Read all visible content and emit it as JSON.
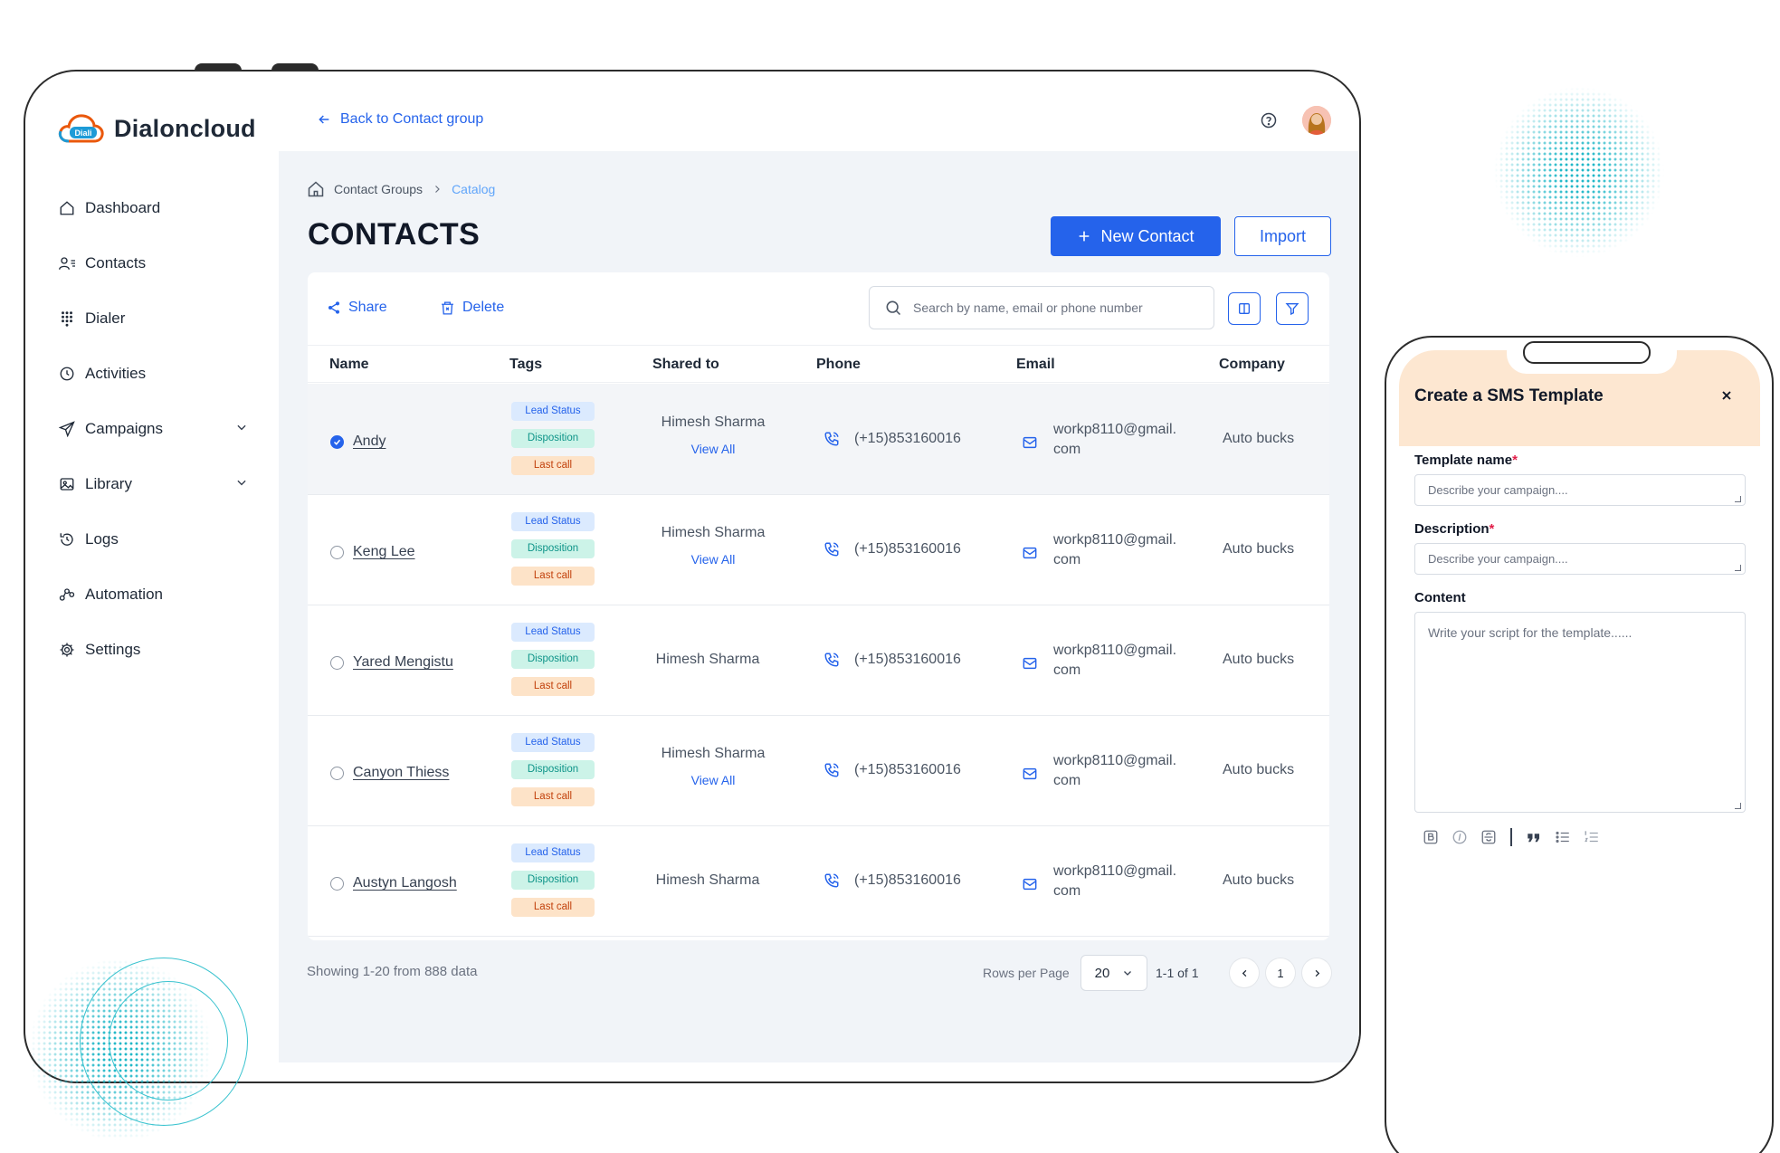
{
  "app": {
    "logo_badge": "Diali",
    "name": "Dialoncloud"
  },
  "sidebar": {
    "items": [
      {
        "label": "Dashboard",
        "icon": "home-icon"
      },
      {
        "label": "Contacts",
        "icon": "users-icon"
      },
      {
        "label": "Dialer",
        "icon": "dialpad-icon"
      },
      {
        "label": "Activities",
        "icon": "clock-icon"
      },
      {
        "label": "Campaigns",
        "icon": "send-icon",
        "expandable": true
      },
      {
        "label": "Library",
        "icon": "image-icon",
        "expandable": true
      },
      {
        "label": "Logs",
        "icon": "history-icon"
      },
      {
        "label": "Automation",
        "icon": "flow-icon"
      },
      {
        "label": "Settings",
        "icon": "gear-icon"
      }
    ]
  },
  "topbar": {
    "back_label": "Back to Contact group"
  },
  "breadcrumb": {
    "parent": "Contact Groups",
    "current": "Catalog"
  },
  "page": {
    "title": "CONTACTS",
    "new_contact_label": "New Contact",
    "import_label": "Import"
  },
  "toolbar": {
    "share_label": "Share",
    "delete_label": "Delete",
    "search_placeholder": "Search by name, email or phone number"
  },
  "table": {
    "columns": [
      "Name",
      "Tags",
      "Shared to",
      "Phone",
      "Email",
      "Company"
    ],
    "tags": [
      "Lead Status",
      "Disposition",
      "Last call"
    ],
    "view_all_label": "View All",
    "rows": [
      {
        "name": "Andy",
        "selected": true,
        "shared_to": "Himesh Sharma",
        "view_all": true,
        "phone": "(+15)853160016",
        "email_1": "workp8110@gmail.",
        "email_2": "com",
        "company": "Auto bucks"
      },
      {
        "name": "Keng Lee",
        "selected": false,
        "shared_to": "Himesh Sharma",
        "view_all": true,
        "phone": "(+15)853160016",
        "email_1": "workp8110@gmail.",
        "email_2": "com",
        "company": "Auto bucks"
      },
      {
        "name": "Yared Mengistu",
        "selected": false,
        "shared_to": "Himesh Sharma",
        "view_all": false,
        "phone": "(+15)853160016",
        "email_1": "workp8110@gmail.",
        "email_2": "com",
        "company": "Auto bucks"
      },
      {
        "name": "Canyon Thiess",
        "selected": false,
        "shared_to": "Himesh Sharma",
        "view_all": true,
        "phone": "(+15)853160016",
        "email_1": "workp8110@gmail.",
        "email_2": "com",
        "company": "Auto bucks"
      },
      {
        "name": "Austyn Langosh",
        "selected": false,
        "shared_to": "Himesh Sharma",
        "view_all": false,
        "phone": "(+15)853160016",
        "email_1": "workp8110@gmail.",
        "email_2": "com",
        "company": "Auto bucks"
      }
    ]
  },
  "footer": {
    "showing": "Showing 1-20 from 888 data",
    "rows_per_page_label": "Rows per Page",
    "rows_per_page": "20",
    "range": "1-1 of 1",
    "page": "1"
  },
  "sms_template": {
    "title": "Create a SMS Template",
    "template_name_label": "Template name",
    "template_name_placeholder": "Describe your campaign....",
    "description_label": "Description",
    "description_placeholder": "Describe your campaign....",
    "content_label": "Content",
    "content_placeholder": "Write your script for the template......",
    "required_mark": "*"
  },
  "colors": {
    "accent": "#2563eb",
    "sms_header": "#fde7d1",
    "tag_lead": "#dbeafe",
    "tag_disposition": "#ccf3e8",
    "tag_last_call": "#fde3c8",
    "decor": "#22b8c8"
  }
}
